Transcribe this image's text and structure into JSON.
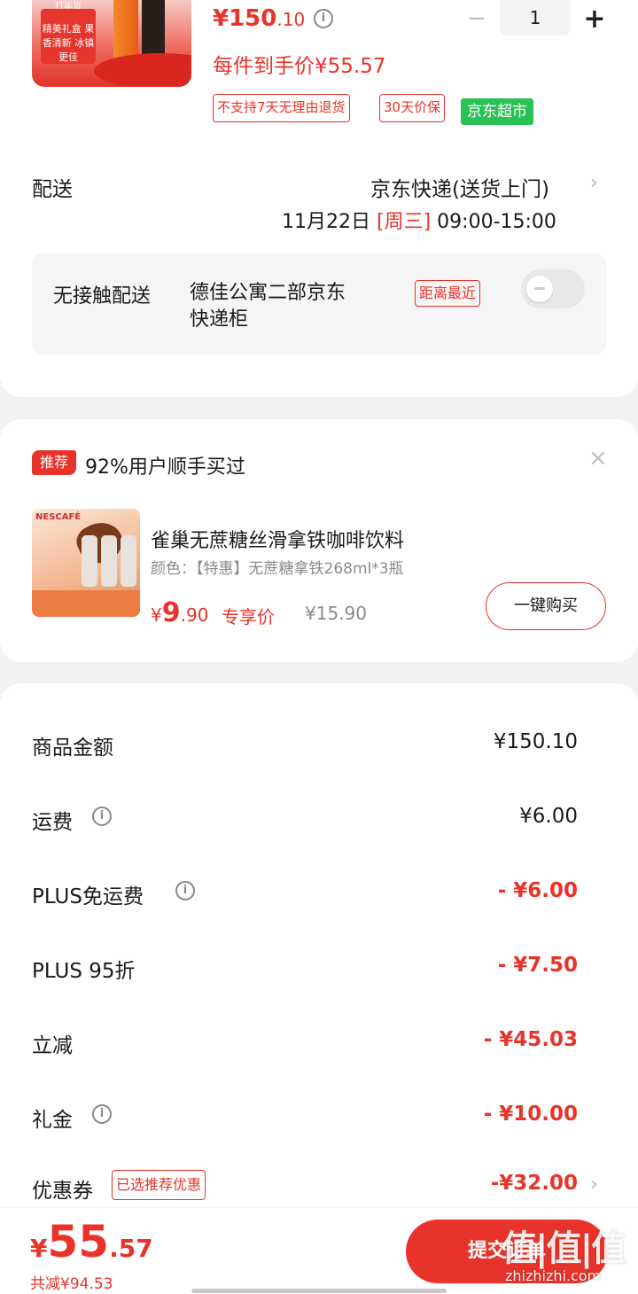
{
  "product": {
    "image_tag_top": "打年货",
    "image_tag_text": "精美礼盒 果香清新 冰镇更佳",
    "price_symbol": "¥",
    "price_int": "150",
    "price_dec": ".10",
    "info_icon": "info-icon",
    "quantity": "1",
    "minus": "−",
    "plus": "+",
    "unit_price": "每件到手价¥55.57",
    "tags": [
      "不支持7天无理由退货",
      "30天价保"
    ],
    "store_tag": "京东超市",
    "colors": {
      "accent": "#e8332a",
      "green": "#2bc255"
    }
  },
  "delivery": {
    "label": "配送",
    "method": "京东快递(送货上门)",
    "date": "11月22日",
    "weekday": "[周三]",
    "time": "09:00-15:00",
    "chevron": "›",
    "contactless_label": "无接触配送",
    "locker_name": "德佳公寓二部京东快递柜",
    "locker_line1": "德佳公寓二部京东",
    "locker_line2": "快递柜",
    "distance_tag": "距离最近",
    "toggle_on": false
  },
  "recommend": {
    "badge": "推荐",
    "headline": "92%用户顺手买过",
    "close": "×",
    "image_brand": "NESCAFÉ",
    "title": "雀巢无蔗糖丝滑拿铁咖啡饮料",
    "spec": "颜色：【特惠】无蔗糖拿铁268ml*3瓶",
    "price_symbol": "¥",
    "price_int": "9",
    "price_dec": ".90",
    "price_tag": "专享价",
    "old_price": "¥15.90",
    "buy_button": "一键购买"
  },
  "summary": {
    "rows": [
      {
        "label": "商品金额",
        "value": "¥150.10",
        "info": false,
        "red": false
      },
      {
        "label": "运费",
        "value": "¥6.00",
        "info": true,
        "red": false
      },
      {
        "label": "PLUS免运费",
        "value": "- ¥6.00",
        "info": true,
        "red": true
      },
      {
        "label": "PLUS 95折",
        "value": "- ¥7.50",
        "info": false,
        "red": true
      },
      {
        "label": "立减",
        "value": "- ¥45.03",
        "info": false,
        "red": true
      },
      {
        "label": "礼金",
        "value": "- ¥10.00",
        "info": true,
        "red": true
      }
    ],
    "coupon_label": "优惠券",
    "coupon_tag": "已选推荐优惠",
    "coupon_value": "-¥32.00",
    "coupon_chevron": "›"
  },
  "bottom": {
    "total_symbol": "¥",
    "total_int": "55",
    "total_dec": ".57",
    "saved": "共减¥94.53",
    "submit": "提交订单",
    "watermark_logo": "值|值|值",
    "watermark_site": "zhizhizhi.com"
  }
}
